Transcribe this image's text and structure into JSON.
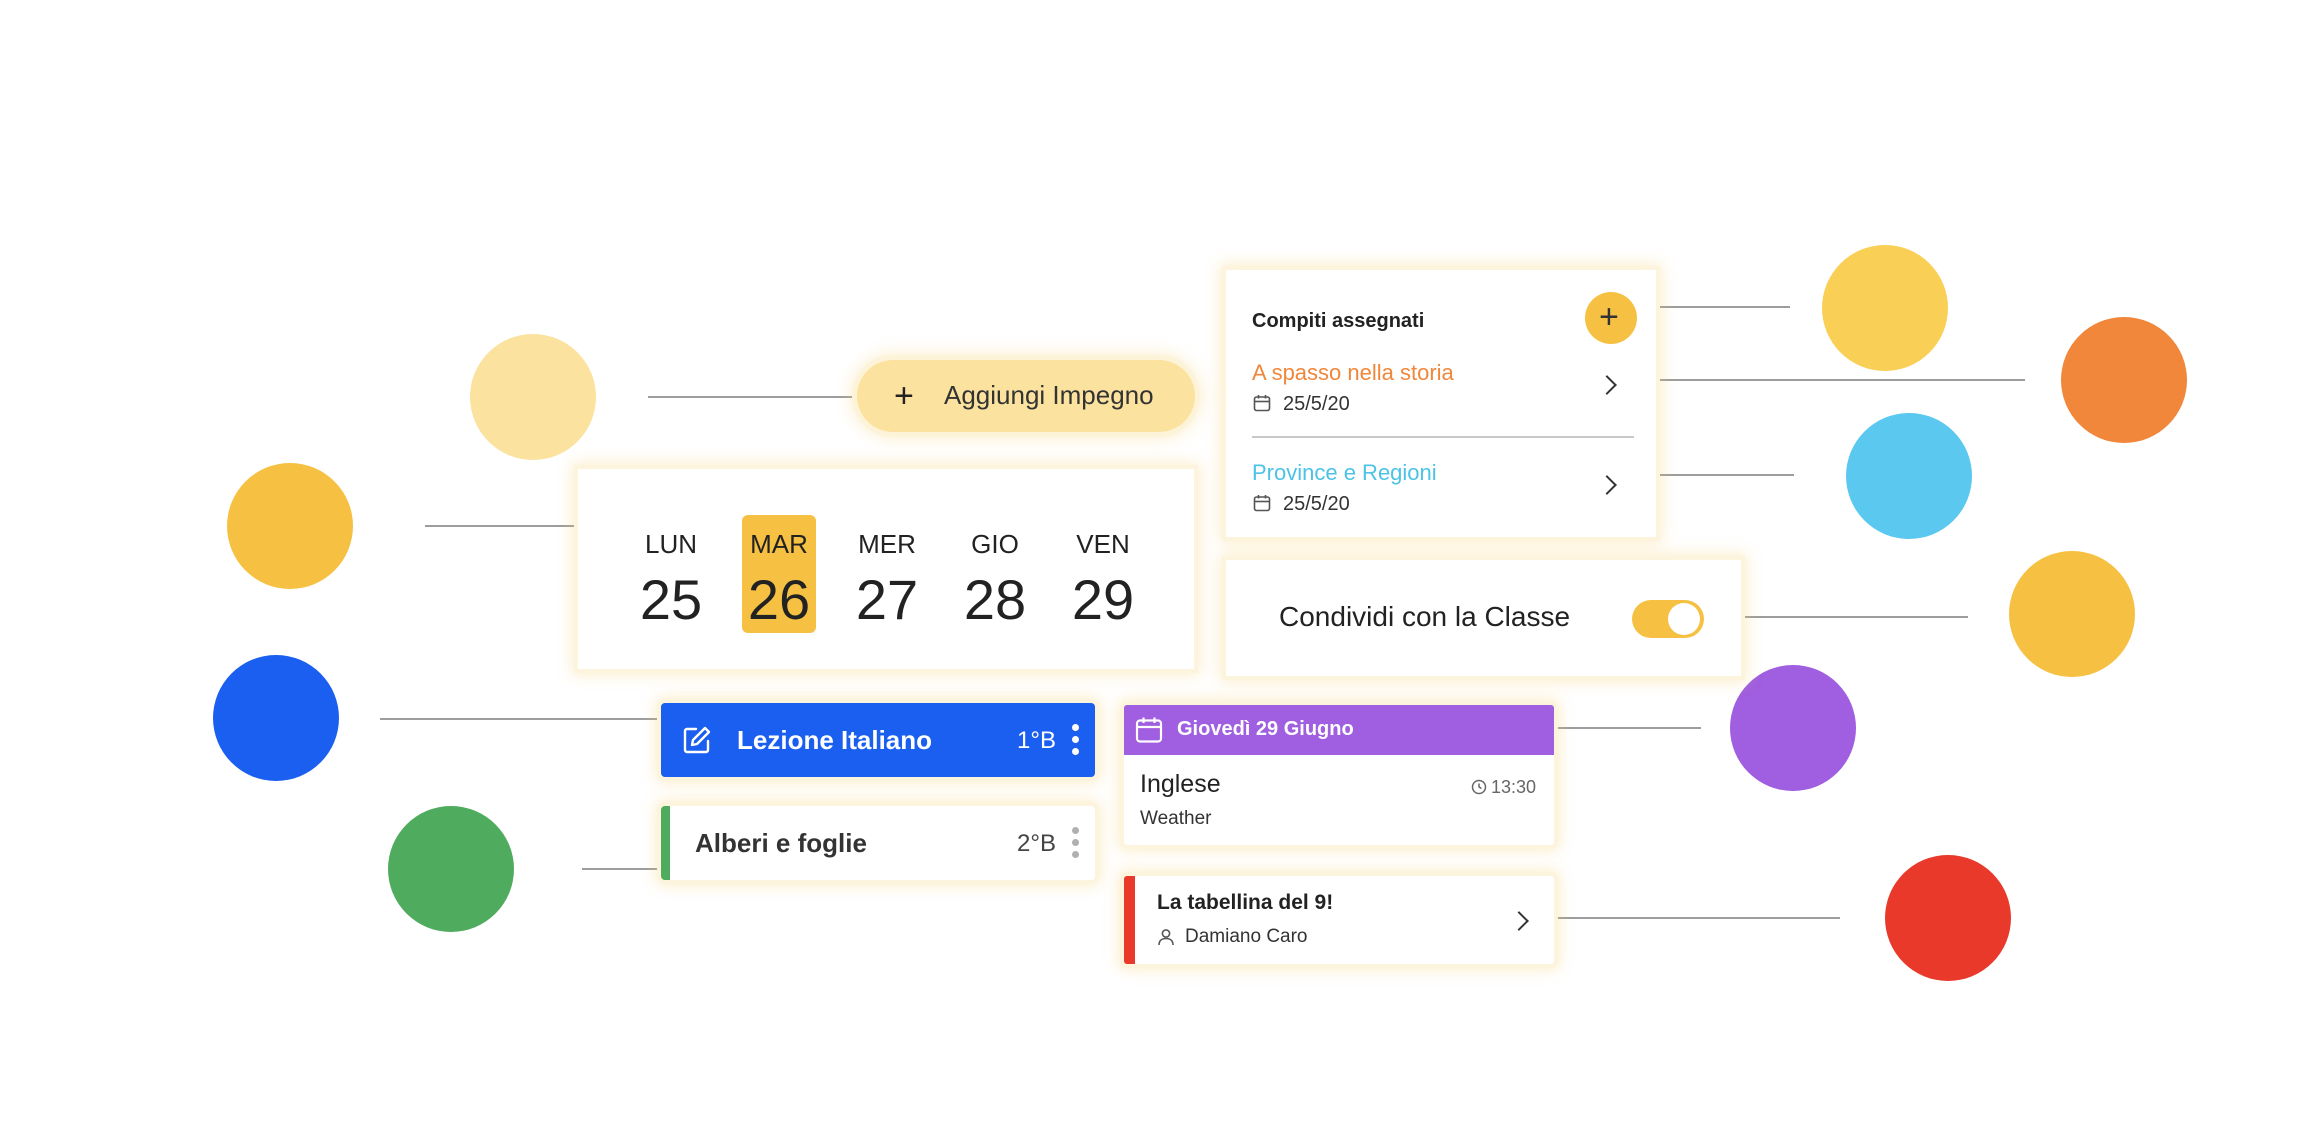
{
  "add_event": {
    "label": "Aggiungi Impegno",
    "icon": "plus-icon"
  },
  "week": {
    "days": [
      {
        "name": "LUN",
        "date": "25"
      },
      {
        "name": "MAR",
        "date": "26"
      },
      {
        "name": "MER",
        "date": "27"
      },
      {
        "name": "GIO",
        "date": "28"
      },
      {
        "name": "VEN",
        "date": "29"
      }
    ],
    "selected_day": "MAR"
  },
  "assignments": {
    "title": "Compiti assegnati",
    "items": [
      {
        "title": "A spasso nella storia",
        "date": "25/5/20",
        "color": "#f0873a"
      },
      {
        "title": "Province e Regioni",
        "date": "25/5/20",
        "color": "#4cc3e6"
      }
    ]
  },
  "share": {
    "label": "Condividi con la Classe",
    "toggle_on": true
  },
  "lessons": [
    {
      "title": "Lezione Italiano",
      "class": "1°B",
      "color": "#1a5ff0",
      "icon": "edit-icon"
    },
    {
      "title": "Alberi e foglie",
      "class": "2°B",
      "color": "#4fac5f"
    }
  ],
  "event_card": {
    "header": "Giovedì 29 Giugno",
    "subject": "Inglese",
    "time": "13:30",
    "topic": "Weather",
    "color": "#a05ee0",
    "icon": "calendar-icon"
  },
  "task_card": {
    "title": "La tabellina del 9!",
    "author": "Damiano Caro",
    "color": "#e8392a",
    "icon": "user-icon"
  },
  "palette": {
    "light_yellow": "#fbe29e",
    "yellow": "#f6c142",
    "yellow_alt": "#f9cf55",
    "orange": "#f0873a",
    "cyan": "#5bc8ef",
    "blue": "#1a5ff0",
    "green": "#4fac5f",
    "purple": "#a05ee0",
    "red": "#e8392a"
  }
}
